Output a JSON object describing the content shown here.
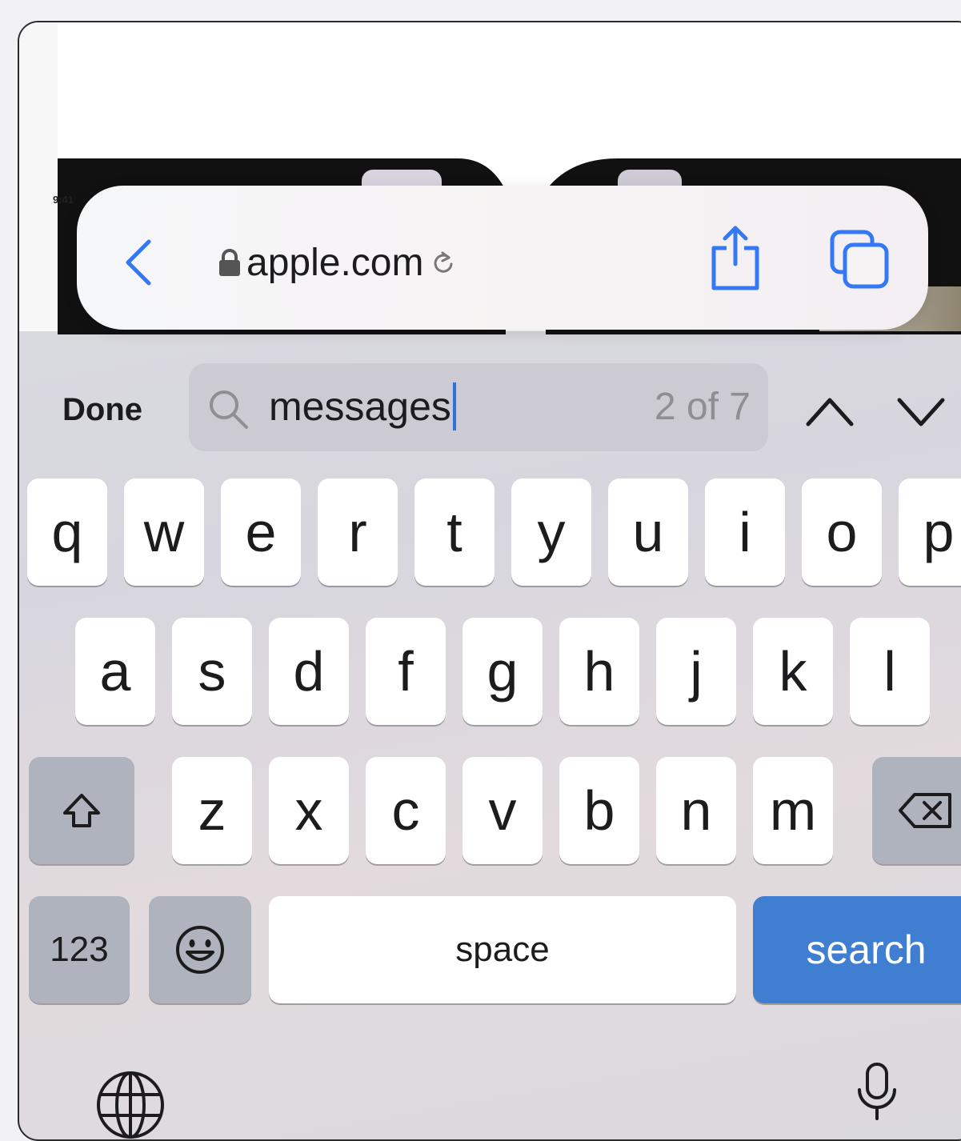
{
  "browser": {
    "status_time": "9:41",
    "url": "apple.com",
    "icons": {
      "back": "chevron-left-icon",
      "lock": "lock-icon",
      "reload": "reload-icon",
      "share": "share-icon",
      "tabs": "tabs-icon"
    },
    "accent_color": "#3478f6"
  },
  "find_bar": {
    "done_label": "Done",
    "query": "messages",
    "match_count": "2 of 7",
    "prev_icon": "chevron-up-icon",
    "next_icon": "chevron-down-icon",
    "search_icon": "magnifying-glass-icon"
  },
  "keyboard": {
    "row1": [
      "q",
      "w",
      "e",
      "r",
      "t",
      "y",
      "u",
      "i",
      "o",
      "p"
    ],
    "row2": [
      "a",
      "s",
      "d",
      "f",
      "g",
      "h",
      "j",
      "k",
      "l"
    ],
    "row3": [
      "z",
      "x",
      "c",
      "v",
      "b",
      "n",
      "m"
    ],
    "numbers_label": "123",
    "space_label": "space",
    "search_label": "search",
    "icons": {
      "shift": "shift-icon",
      "backspace": "backspace-icon",
      "emoji": "emoji-icon",
      "globe": "globe-icon",
      "mic": "microphone-icon"
    },
    "search_key_color": "#3f7ed0"
  }
}
